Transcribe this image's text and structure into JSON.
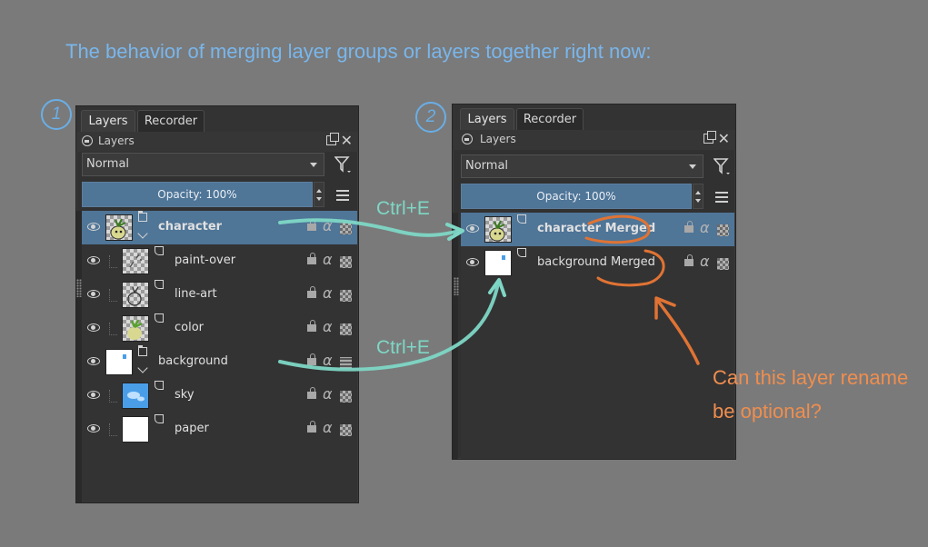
{
  "headline": "The behavior of merging layer groups or layers together right now:",
  "steps": [
    "1",
    "2"
  ],
  "panel1": {
    "tabs": [
      {
        "label": "Layers",
        "active": true
      },
      {
        "label": "Recorder",
        "active": false
      }
    ],
    "dock_title": "Layers",
    "blend_mode": "Normal",
    "opacity": "Opacity:  100%",
    "layers": [
      {
        "name": "character",
        "type": "group",
        "selected": true,
        "indent": 0,
        "thumb": "character"
      },
      {
        "name": "paint-over",
        "type": "paint",
        "selected": false,
        "indent": 1,
        "thumb": "paintover"
      },
      {
        "name": "line-art",
        "type": "paint",
        "selected": false,
        "indent": 1,
        "thumb": "lineart"
      },
      {
        "name": "color",
        "type": "paint",
        "selected": false,
        "indent": 1,
        "thumb": "color"
      },
      {
        "name": "background",
        "type": "group",
        "selected": false,
        "indent": 0,
        "thumb": "background"
      },
      {
        "name": "sky",
        "type": "paint",
        "selected": false,
        "indent": 1,
        "thumb": "sky"
      },
      {
        "name": "paper",
        "type": "paint",
        "selected": false,
        "indent": 1,
        "thumb": "paper"
      }
    ]
  },
  "panel2": {
    "tabs": [
      {
        "label": "Layers",
        "active": true
      },
      {
        "label": "Recorder",
        "active": false
      }
    ],
    "dock_title": "Layers",
    "blend_mode": "Normal",
    "opacity": "Opacity:  100%",
    "layers": [
      {
        "name": "character Merged",
        "type": "paint",
        "selected": true,
        "thumb": "character"
      },
      {
        "name": "background Merged",
        "type": "paint",
        "selected": false,
        "thumb": "background"
      }
    ]
  },
  "annotations": {
    "shortcut_1": "Ctrl+E",
    "shortcut_2": "Ctrl+E",
    "question_line1": "Can this layer rename",
    "question_line2": "be optional?",
    "arrow_color": "#7ed7c5",
    "note_color": "#ef8e4f"
  },
  "icons": [
    "eye-icon",
    "lock-icon",
    "alpha-icon",
    "checker-icon",
    "filter-icon",
    "menu-icon",
    "float-icon",
    "close-icon",
    "group-icon",
    "paint-layer-icon"
  ]
}
